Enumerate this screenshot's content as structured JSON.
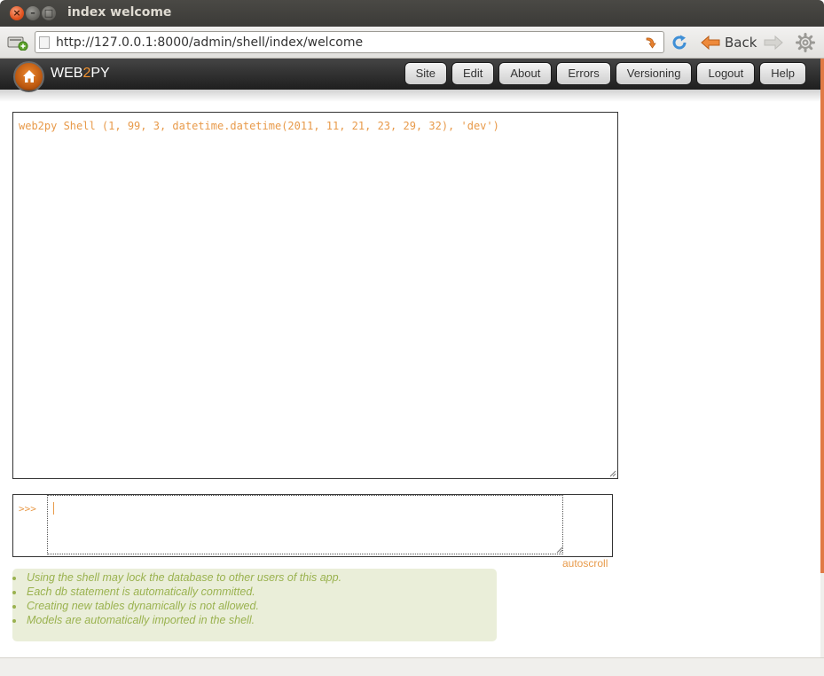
{
  "window": {
    "title": "index welcome"
  },
  "browser": {
    "url": "http://127.0.0.1:8000/admin/shell/index/welcome",
    "back_label": "Back"
  },
  "header": {
    "logo_pre": "WEB",
    "logo_accent": "2",
    "logo_post": "PY",
    "menu": [
      {
        "label": "Site"
      },
      {
        "label": "Edit"
      },
      {
        "label": "About"
      },
      {
        "label": "Errors"
      },
      {
        "label": "Versioning"
      },
      {
        "label": "Logout"
      },
      {
        "label": "Help"
      }
    ]
  },
  "shell": {
    "output": "web2py Shell (1, 99, 3, datetime.datetime(2011, 11, 21, 23, 29, 32), 'dev')",
    "prompt": ">>>",
    "input_value": "",
    "autoscroll_label": "autoscroll"
  },
  "notes": [
    "Using the shell may lock the database to other users of this app.",
    "Each db statement is automatically committed.",
    "Creating new tables dynamically is not allowed.",
    "Models are automatically imported in the shell."
  ],
  "colors": {
    "accent_orange": "#e89a4a",
    "notes_green": "#9ab24f",
    "notes_bg": "#eaeed9"
  }
}
